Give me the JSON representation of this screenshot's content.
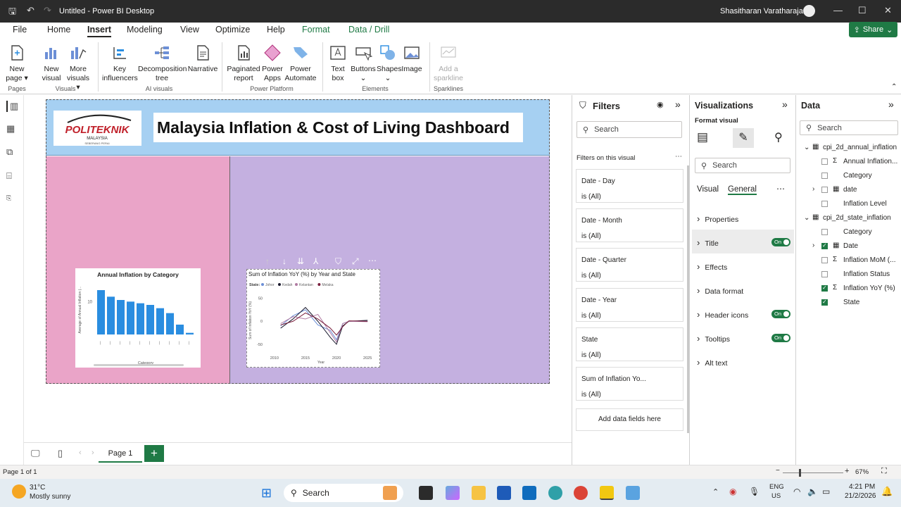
{
  "window": {
    "title": "Untitled - Power BI Desktop",
    "user": "Shasitharan Varatharajan"
  },
  "menu": {
    "tabs": [
      "File",
      "Home",
      "Insert",
      "Modeling",
      "View",
      "Optimize",
      "Help",
      "Format",
      "Data / Drill"
    ],
    "active": "Insert",
    "share": "Share"
  },
  "ribbon": {
    "buttons": [
      {
        "label": "New page",
        "group": "Pages"
      },
      {
        "label": "New visual",
        "group": "Visuals"
      },
      {
        "label": "More visuals",
        "group": "Visuals"
      },
      {
        "label": "Key influencers",
        "group": "AI visuals"
      },
      {
        "label": "Decomposition tree",
        "group": "AI visuals"
      },
      {
        "label": "Narrative",
        "group": "AI visuals"
      },
      {
        "label": "Paginated report",
        "group": "Power Platform"
      },
      {
        "label": "Power Apps",
        "group": "Power Platform"
      },
      {
        "label": "Power Automate",
        "group": "Power Platform"
      },
      {
        "label": "Text box",
        "group": "Elements"
      },
      {
        "label": "Buttons",
        "group": "Elements"
      },
      {
        "label": "Shapes",
        "group": "Elements"
      },
      {
        "label": "Image",
        "group": "Elements"
      },
      {
        "label": "Add a sparkline",
        "group": "Sparklines"
      }
    ],
    "groups": [
      "Pages",
      "Visuals",
      "AI visuals",
      "Power Platform",
      "Elements",
      "Sparklines"
    ]
  },
  "report": {
    "logo": {
      "text": "POLITEKNIK",
      "sub": "MALAYSIA",
      "sub2": "SEBERANG PERAI"
    },
    "title": "Malaysia Inflation & Cost of Living Dashboard",
    "chart1": {
      "title": "Annual Inflation by Category",
      "ylabel": "Average of Annual Inflation (...",
      "xlabel": "Category",
      "ytick": "10"
    },
    "chart2": {
      "title": "Sum of Inflation YoY (%) by Year and State",
      "legend_title": "State",
      "legend": [
        "Johor",
        "Kedah",
        "Kelantan",
        "Melaka"
      ],
      "xticks": [
        "2010",
        "2015",
        "2020",
        "2025"
      ],
      "yticks": [
        "50",
        "0",
        "-50"
      ],
      "xlabel": "Year",
      "ylabel": "Sum of Inflation YoY (%)"
    }
  },
  "chart_data": [
    {
      "type": "bar",
      "title": "Annual Inflation by Category",
      "ylabel": "Average of Annual Inflation (...",
      "xlabel": "Category",
      "values": [
        13.5,
        11.5,
        10.5,
        10,
        9.5,
        9,
        8,
        6.5,
        3,
        0.5
      ],
      "color": "#2a8de0"
    },
    {
      "type": "line",
      "title": "Sum of Inflation YoY (%) by Year and State",
      "xlabel": "Year",
      "ylabel": "Sum of Inflation YoY (%)",
      "ylim": [
        -70,
        60
      ],
      "series": [
        {
          "name": "Johor",
          "color": "#6c8fd6",
          "x": [
            2011,
            2013,
            2015,
            2017,
            2019,
            2020,
            2021,
            2022,
            2025
          ],
          "y": [
            -10,
            12,
            25,
            -8,
            -20,
            -40,
            -5,
            0,
            0
          ]
        },
        {
          "name": "Kedah",
          "color": "#1a1a2e",
          "x": [
            2011,
            2013,
            2015,
            2017,
            2019,
            2020,
            2021,
            2022,
            2025
          ],
          "y": [
            -15,
            5,
            30,
            0,
            -35,
            -50,
            -10,
            0,
            2
          ]
        },
        {
          "name": "Kelantan",
          "color": "#b07aa1",
          "x": [
            2011,
            2013,
            2015,
            2017,
            2019,
            2020,
            2021,
            2022,
            2025
          ],
          "y": [
            -5,
            10,
            5,
            15,
            -25,
            -45,
            -5,
            0,
            -1
          ]
        },
        {
          "name": "Melaka",
          "color": "#7a1f3d",
          "x": [
            2011,
            2013,
            2015,
            2017,
            2019,
            2020,
            2021,
            2022,
            2025
          ],
          "y": [
            -8,
            0,
            18,
            5,
            -15,
            -30,
            -12,
            1,
            0
          ]
        }
      ]
    }
  ],
  "filters": {
    "title": "Filters",
    "search": "Search",
    "section": "Filters on this visual",
    "items": [
      {
        "name": "Date - Day",
        "value": "is (All)"
      },
      {
        "name": "Date - Month",
        "value": "is (All)"
      },
      {
        "name": "Date - Quarter",
        "value": "is (All)"
      },
      {
        "name": "Date - Year",
        "value": "is (All)"
      },
      {
        "name": "State",
        "value": "is (All)"
      },
      {
        "name": "Sum of Inflation Yo...",
        "value": "is (All)"
      }
    ],
    "add": "Add data fields here"
  },
  "viz": {
    "title": "Visualizations",
    "format_label": "Format visual",
    "search": "Search",
    "tab_visual": "Visual",
    "tab_general": "General",
    "sections": [
      {
        "label": "Properties",
        "toggle": ""
      },
      {
        "label": "Title",
        "toggle": "On"
      },
      {
        "label": "Effects",
        "toggle": ""
      },
      {
        "label": "Data format",
        "toggle": ""
      },
      {
        "label": "Header icons",
        "toggle": "On"
      },
      {
        "label": "Tooltips",
        "toggle": "On"
      },
      {
        "label": "Alt text",
        "toggle": ""
      }
    ]
  },
  "data": {
    "title": "Data",
    "search": "Search",
    "tables": [
      {
        "name": "cpi_2d_annual_inflation",
        "fields": [
          {
            "label": "Annual Inflation...",
            "checked": false
          },
          {
            "label": "Category",
            "checked": false
          },
          {
            "label": "date",
            "checked": false
          },
          {
            "label": "Inflation Level",
            "checked": false
          }
        ]
      },
      {
        "name": "cpi_2d_state_inflation",
        "fields": [
          {
            "label": "Category",
            "checked": false
          },
          {
            "label": "Date",
            "checked": true
          },
          {
            "label": "Inflation MoM (...",
            "checked": false
          },
          {
            "label": "Inflation Status",
            "checked": false
          },
          {
            "label": "Inflation YoY (%)",
            "checked": true
          },
          {
            "label": "State",
            "checked": true
          }
        ]
      }
    ]
  },
  "pages": {
    "current": "Page 1",
    "status": "Page 1 of 1",
    "zoom": "67%"
  },
  "taskbar": {
    "temp": "31°C",
    "weather": "Mostly sunny",
    "search": "Search",
    "lang1": "ENG",
    "lang2": "US",
    "time": "4:21 PM",
    "date": "21/2/2026"
  }
}
